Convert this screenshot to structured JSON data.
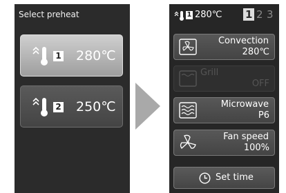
{
  "left_screen": {
    "header": "Select preheat",
    "presets": [
      {
        "number": "1",
        "temp": "280℃",
        "selected": true,
        "icon": "preheat-thermometer-icon"
      },
      {
        "number": "2",
        "temp": "250℃",
        "selected": false,
        "icon": "preheat-thermometer-icon"
      }
    ]
  },
  "right_screen": {
    "status": {
      "preset_number": "1",
      "temp": "280℃",
      "icon": "preheat-thermometer-icon"
    },
    "pages": [
      "1",
      "2",
      "3"
    ],
    "current_page": "1",
    "options": [
      {
        "label": "Convection",
        "value": "280℃",
        "icon": "fan-icon",
        "enabled": true
      },
      {
        "label": "Grill",
        "value": "OFF",
        "icon": "grill-icon",
        "enabled": false
      },
      {
        "label": "Microwave",
        "value": "P6",
        "icon": "microwave-icon",
        "enabled": true
      },
      {
        "label": "Fan speed",
        "value": "100%",
        "icon": "fan-speed-icon",
        "enabled": true
      }
    ],
    "set_time": {
      "label": "Set time",
      "icon": "clock-icon"
    }
  },
  "colors": {
    "screen_bg": "#2b2b2b",
    "selected_button": "#b8b8b8",
    "arrow": "#a9a9a9"
  }
}
